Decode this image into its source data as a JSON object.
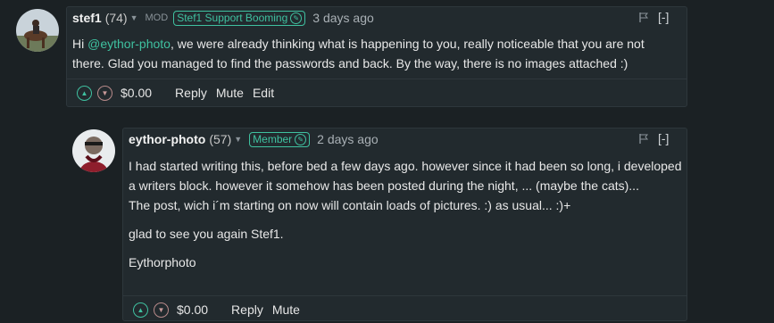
{
  "comments": [
    {
      "author": "stef1",
      "reputation": "(74)",
      "role": "MOD",
      "badge": "Stef1 Support Booming",
      "time": "3 days ago",
      "collapse": "[-]",
      "body": {
        "pre": "Hi ",
        "mention": "@eythor-photo",
        "post": ", we were already thinking what is happening to you, really noticeable that you are not there. Glad you managed to find the passwords and back. By the way, there is no images attached :)"
      },
      "payout": "$0.00",
      "actions": [
        "Reply",
        "Mute",
        "Edit"
      ]
    },
    {
      "author": "eythor-photo",
      "reputation": "(57)",
      "badge": "Member",
      "time": "2 days ago",
      "collapse": "[-]",
      "paragraphs": [
        "I had started writing this, before bed a few days ago. however since it had been so long, i developed a writers block. however it somehow has been posted during the night, ... (maybe the cats)...",
        "The post, wich i´m starting on now will contain loads of pictures. :) as usual... :)+",
        "glad to see you again Stef1.",
        "Eythorphoto"
      ],
      "payout": "$0.00",
      "actions": [
        "Reply",
        "Mute"
      ]
    }
  ]
}
